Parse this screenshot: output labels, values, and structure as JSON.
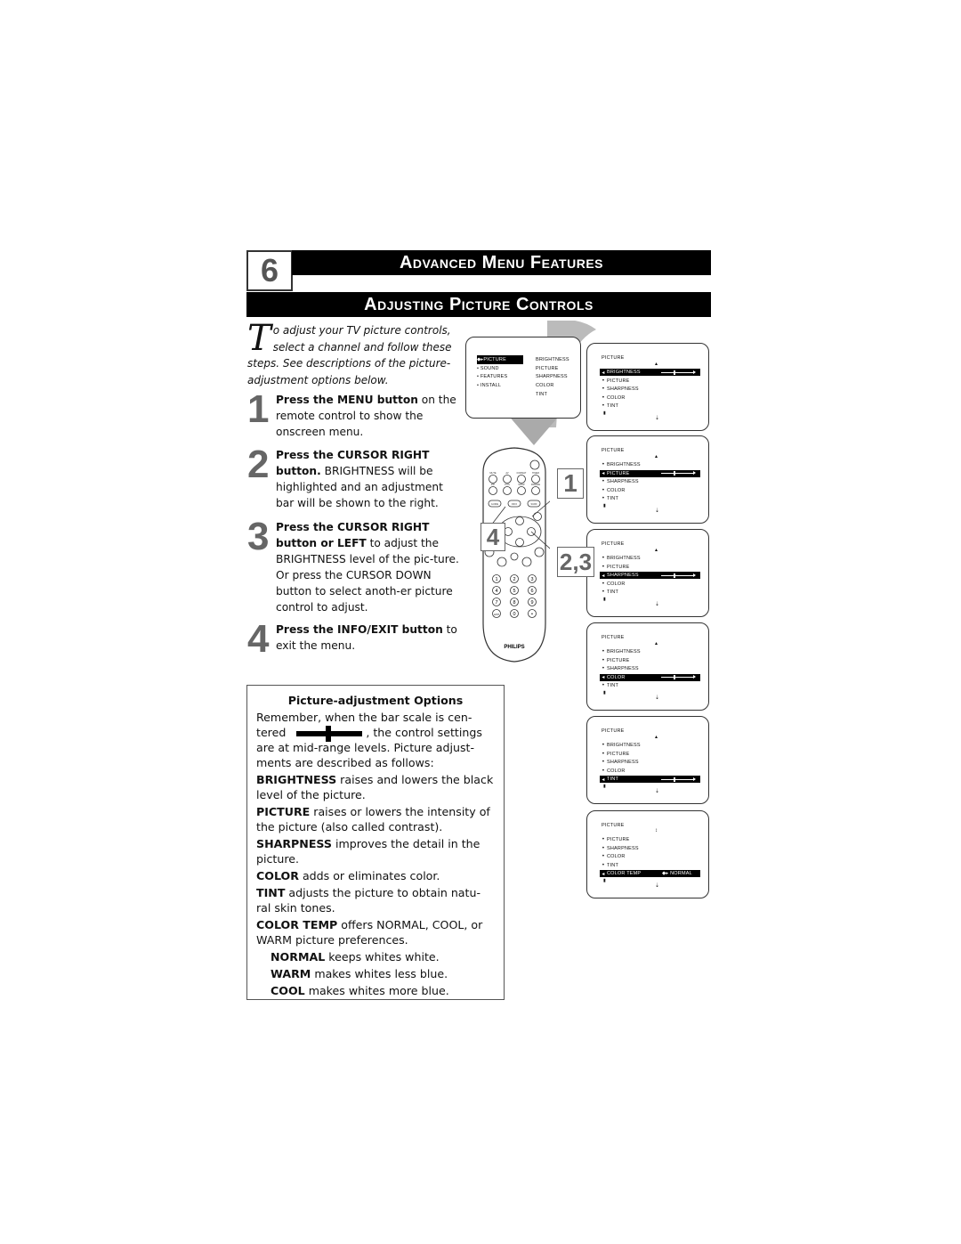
{
  "header": {
    "section_number": "6",
    "section_title": "Advanced Menu Features",
    "page_title": "Adjusting Picture Controls"
  },
  "intro": {
    "dropcap": "T",
    "text": "o adjust your TV picture controls, select a channel and follow these steps. See descriptions of the picture-adjustment options below."
  },
  "steps": [
    {
      "number": "1",
      "bold": "Press the MENU button",
      "text": " on the remote control to show the onscreen menu."
    },
    {
      "number": "2",
      "bold": "Press the CURSOR RIGHT button.",
      "text": " BRIGHTNESS will be highlighted and an adjustment bar will be shown to the right."
    },
    {
      "number": "3",
      "bold": "Press the CURSOR RIGHT button or LEFT",
      "text": " to adjust the BRIGHTNESS level of the pic-ture. Or press the CURSOR DOWN button to select anoth-er picture control to adjust."
    },
    {
      "number": "4",
      "bold": "Press the INFO/EXIT button",
      "text": " to exit the menu."
    }
  ],
  "options": {
    "title": "Picture-adjustment Options",
    "intro_a": "Remember, when the bar scale is cen-tered",
    "intro_b": ", the control settings are at mid-range levels. Picture adjust-ments are described as follows:",
    "items": [
      {
        "term": "BRIGHTNESS",
        "desc": " raises and lowers the black level of the picture."
      },
      {
        "term": "PICTURE",
        "desc": " raises or lowers the intensity of the picture (also called contrast)."
      },
      {
        "term": "SHARPNESS",
        "desc": " improves the detail in the picture."
      },
      {
        "term": "COLOR",
        "desc": " adds or eliminates color."
      },
      {
        "term": "TINT",
        "desc": " adjusts the picture to obtain natu-ral skin tones."
      },
      {
        "term": "COLOR TEMP",
        "desc": " offers NORMAL, COOL, or WARM picture preferences."
      }
    ],
    "sub_items": [
      {
        "term": "NORMAL",
        "desc": " keeps whites white."
      },
      {
        "term": "WARM",
        "desc": " makes whites less blue."
      },
      {
        "term": "COOL",
        "desc": " makes whites more blue."
      }
    ]
  },
  "main_menu": {
    "items": [
      "PICTURE",
      "SOUND",
      "FEATURES",
      "INSTALL"
    ],
    "selected_index": 0,
    "submenu": [
      "BRIGHTNESS",
      "PICTURE",
      "SHARPNESS",
      "COLOR",
      "TINT"
    ]
  },
  "screens": [
    {
      "header": "PICTURE",
      "items": [
        "BRIGHTNESS",
        "PICTURE",
        "SHARPNESS",
        "COLOR",
        "TINT"
      ],
      "selected": 0,
      "slider_value": 0.5
    },
    {
      "header": "PICTURE",
      "items": [
        "BRIGHTNESS",
        "PICTURE",
        "SHARPNESS",
        "COLOR",
        "TINT"
      ],
      "selected": 1,
      "slider_value": 0.5
    },
    {
      "header": "PICTURE",
      "items": [
        "BRIGHTNESS",
        "PICTURE",
        "SHARPNESS",
        "COLOR",
        "TINT"
      ],
      "selected": 2,
      "slider_value": 0.5
    },
    {
      "header": "PICTURE",
      "items": [
        "BRIGHTNESS",
        "PICTURE",
        "SHARPNESS",
        "COLOR",
        "TINT"
      ],
      "selected": 3,
      "slider_value": 0.5
    },
    {
      "header": "PICTURE",
      "items": [
        "BRIGHTNESS",
        "PICTURE",
        "SHARPNESS",
        "COLOR",
        "TINT"
      ],
      "selected": 4,
      "slider_value": 0.5
    },
    {
      "header": "PICTURE",
      "items": [
        "PICTURE",
        "SHARPNESS",
        "COLOR",
        "TINT",
        "COLOR TEMP"
      ],
      "selected": 4,
      "value_text": "NORMAL"
    }
  ],
  "remote": {
    "brand": "PHILIPS",
    "top_labels": [
      "MUTE",
      "AV",
      "FORMAT",
      "TIMER"
    ],
    "second_labels": [
      "PIP",
      "POS",
      "SWAP",
      "FREEZE"
    ],
    "mid_labels": [
      "GUIDE",
      "INFO",
      "SURF"
    ],
    "exit_label": "EXIT",
    "menu_label": "MENU",
    "vol_label": "VOL",
    "ch_label": "CH",
    "digits": [
      "1",
      "2",
      "3",
      "4",
      "5",
      "6",
      "7",
      "8",
      "9",
      "A/CH",
      "0",
      "•"
    ],
    "callouts": [
      "1",
      "4",
      "2,3"
    ]
  }
}
